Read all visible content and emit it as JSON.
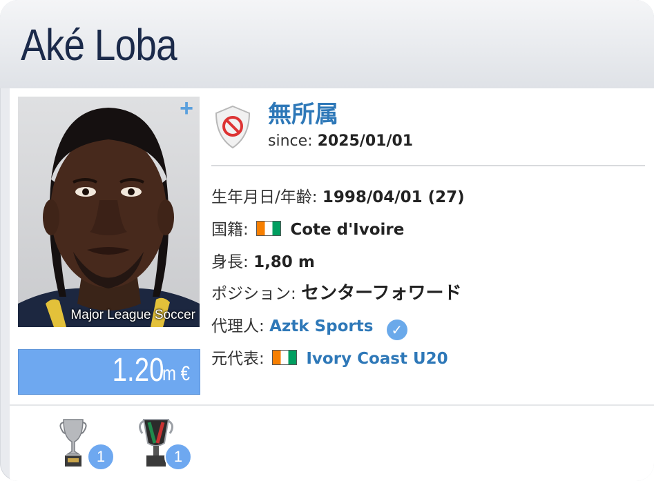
{
  "player": {
    "name": "Aké Loba",
    "photo_caption": "Major League Soccer",
    "market_value": "1.20",
    "market_value_unit": "m €"
  },
  "club": {
    "name": "無所属",
    "since_label": "since:",
    "since_date": "2025/01/01",
    "crest_icon": "no-club-crest-icon"
  },
  "info": {
    "birth_label": "生年月日/年齢:",
    "birth_value": "1998/04/01 (27)",
    "nationality_label": "国籍:",
    "nationality_value": "Cote d'Ivoire",
    "height_label": "身長:",
    "height_value": "1,80 m",
    "position_label": "ポジション:",
    "position_value": "センターフォワード",
    "agent_label": "代理人:",
    "agent_value": "Aztk Sports",
    "national_team_label": "元代表:",
    "national_team_value": "Ivory Coast U20"
  },
  "trophies": [
    {
      "icon": "silver-trophy-icon",
      "count": "1"
    },
    {
      "icon": "cup-trophy-icon",
      "count": "1"
    }
  ],
  "colors": {
    "accent": "#2e78b8",
    "value_box": "#6ea8f0",
    "title": "#1b2a4a",
    "flag_orange": "#f77f00",
    "flag_green": "#009e60"
  }
}
